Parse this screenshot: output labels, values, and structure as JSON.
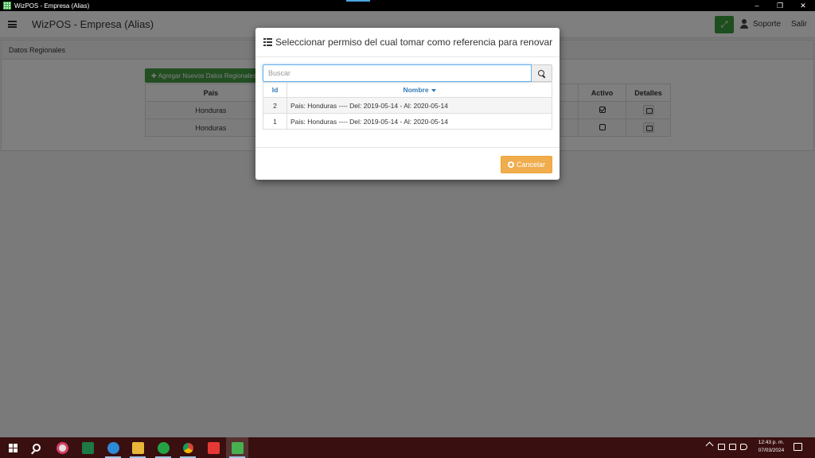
{
  "window": {
    "title": "WizPOS - Empresa (Alias)",
    "controls": {
      "minimize": "–",
      "restore": "❐",
      "close": "✕"
    }
  },
  "app": {
    "brand": "WizPOS - Empresa (Alias)",
    "nav": {
      "soporte": "Soporte",
      "salir": "Salir"
    },
    "panel_title": "Datos Regionales",
    "add_button": "Agregar Nuevos Datos Regionales",
    "table": {
      "headers": {
        "pais": "Pais",
        "activo": "Activo",
        "detalles": "Detalles"
      },
      "rows": [
        {
          "pais": "Honduras",
          "activo": true
        },
        {
          "pais": "Honduras",
          "activo": false
        }
      ]
    }
  },
  "modal": {
    "title": "Seleccionar permiso del cual tomar como referencia para renovar",
    "search_placeholder": "Buscar",
    "search_value": "",
    "columns": {
      "id": "Id",
      "nombre": "Nombre"
    },
    "rows": [
      {
        "id": "2",
        "nombre": "Pais: Honduras ---- Del: 2019-05-14 - Al: 2020-05-14"
      },
      {
        "id": "1",
        "nombre": "Pais: Honduras ---- Del: 2019-05-14 - Al: 2020-05-14"
      }
    ],
    "cancel_label": "Cancelar"
  },
  "taskbar": {
    "time": "12:43 p. m.",
    "date": "07/03/2024",
    "apps": [
      "search-icon",
      "slack-icon",
      "excel-icon",
      "teams-icon",
      "file-explorer-icon",
      "whatsapp-icon",
      "chrome-icon",
      "anydesk-icon",
      "wizpos-icon"
    ],
    "colors": {
      "taskbar": "#3a0f0f",
      "accent": "#337ab7",
      "warning": "#f0ad4e",
      "success": "#449d44"
    }
  }
}
